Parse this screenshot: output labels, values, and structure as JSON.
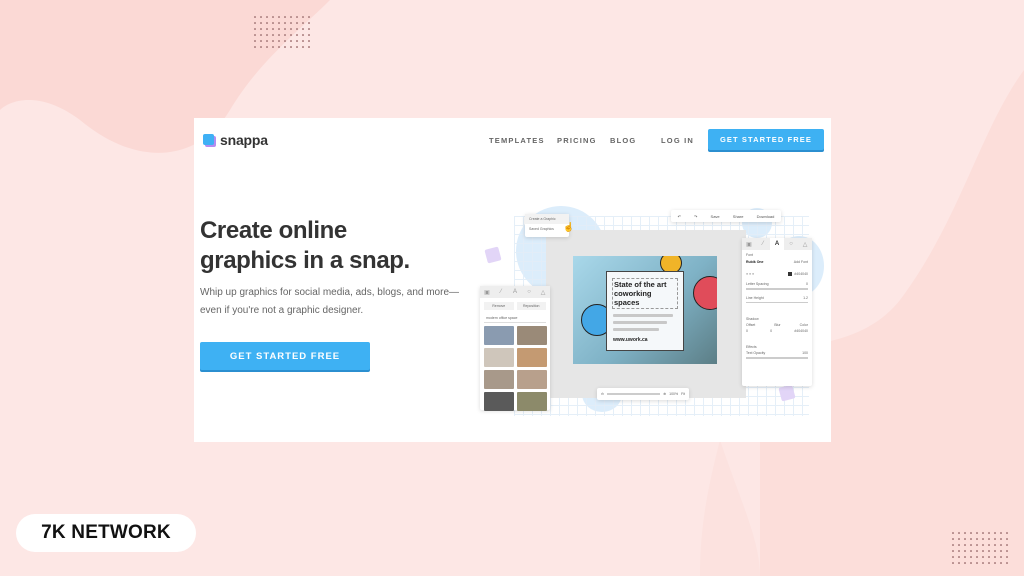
{
  "site": {
    "logo_text": "snappa",
    "nav": {
      "templates": "TEMPLATES",
      "pricing": "PRICING",
      "blog": "BLOG",
      "login": "LOG IN",
      "cta": "GET STARTED FREE"
    },
    "hero": {
      "title_line1": "Create online",
      "title_line2": "graphics in a snap.",
      "subtitle": "Whip up graphics for social media, ads, blogs, and more—even if you're not a graphic designer.",
      "cta": "GET STARTED FREE"
    },
    "editor_mock": {
      "popup_items": [
        "Create a Graphic",
        "Saved Graphics"
      ],
      "toolbar": [
        "Undo",
        "Redo",
        "Save",
        "Share",
        "Download"
      ],
      "left_panel": {
        "remove_label": "Remove",
        "reposition_label": "Reposition",
        "search_value": "modern office space"
      },
      "right_panel": {
        "font_section": "Font",
        "font_name": "Rubik One",
        "add_font": "Add Font",
        "color_value": "#404040",
        "letter_spacing_label": "Letter Spacing",
        "letter_spacing_value": "0",
        "line_height_label": "Line Height",
        "line_height_value": "1.2",
        "shadow_section": "Shadow",
        "offset_label": "Offset",
        "blur_label": "Blur",
        "color_label": "Color",
        "offset_value": "0",
        "blur_value": "0",
        "shadow_color": "#404040",
        "effects_section": "Effects",
        "text_opacity_label": "Text Opacity",
        "text_opacity_value": "100"
      },
      "graphic": {
        "title": "State of the art coworking spaces",
        "url": "www.uwork.ca"
      },
      "zoom_value": "100%",
      "fit_label": "Fit"
    }
  },
  "badge": {
    "text": "7K NETWORK"
  },
  "colors": {
    "background": "#fde7e5",
    "blob": "#fbdcd8",
    "accent": "#3eb1f3",
    "logo_secondary": "#b48cf0"
  }
}
